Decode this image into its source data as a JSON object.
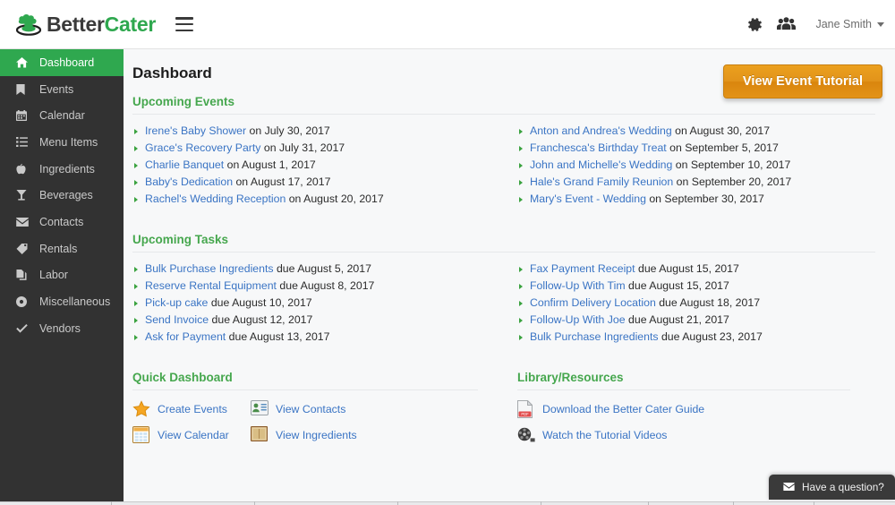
{
  "app": {
    "brand_primary": "Better",
    "brand_secondary": "Cater",
    "accent_green": "#2fa84f",
    "link_blue": "#3a74c4",
    "sidebar_bg": "#323232",
    "button_orange": "#e2931a"
  },
  "header": {
    "menu_icon": "hamburger-icon",
    "settings_icon": "gear-icon",
    "users_icon": "users-group-icon",
    "user_name": "Jane Smith",
    "user_caret": "chevron-down-icon"
  },
  "sidebar": {
    "items": [
      {
        "label": "Dashboard",
        "icon": "home-icon",
        "active": true
      },
      {
        "label": "Events",
        "icon": "bookmark-icon",
        "active": false
      },
      {
        "label": "Calendar",
        "icon": "calendar-icon",
        "active": false
      },
      {
        "label": "Menu Items",
        "icon": "list-icon",
        "active": false
      },
      {
        "label": "Ingredients",
        "icon": "apple-icon",
        "active": false
      },
      {
        "label": "Beverages",
        "icon": "cocktail-glass-icon",
        "active": false
      },
      {
        "label": "Contacts",
        "icon": "envelope-icon",
        "active": false
      },
      {
        "label": "Rentals",
        "icon": "tag-icon",
        "active": false
      },
      {
        "label": "Labor",
        "icon": "copy-icon",
        "active": false
      },
      {
        "label": "Miscellaneous",
        "icon": "circle-dot-icon",
        "active": false
      },
      {
        "label": "Vendors",
        "icon": "check-icon",
        "active": false
      }
    ]
  },
  "main": {
    "page_title": "Dashboard",
    "tutorial_button": "View Event Tutorial",
    "events": {
      "section_title": "Upcoming Events",
      "left": [
        {
          "name": "Irene's Baby Shower",
          "suffix": " on July 30, 2017"
        },
        {
          "name": "Grace's Recovery Party",
          "suffix": " on July 31, 2017"
        },
        {
          "name": "Charlie Banquet",
          "suffix": " on August 1, 2017"
        },
        {
          "name": "Baby's Dedication",
          "suffix": " on August 17, 2017"
        },
        {
          "name": "Rachel's Wedding Reception",
          "suffix": " on August 20, 2017"
        }
      ],
      "right": [
        {
          "name": "Anton and Andrea's Wedding",
          "suffix": " on August 30, 2017"
        },
        {
          "name": "Franchesca's Birthday Treat",
          "suffix": " on September 5, 2017"
        },
        {
          "name": "John and Michelle's Wedding",
          "suffix": " on September 10, 2017"
        },
        {
          "name": "Hale's Grand Family Reunion",
          "suffix": " on September 20, 2017"
        },
        {
          "name": "Mary's Event - Wedding",
          "suffix": " on September 30, 2017"
        }
      ]
    },
    "tasks": {
      "section_title": "Upcoming Tasks",
      "left": [
        {
          "name": "Bulk Purchase Ingredients",
          "suffix": " due August 5, 2017"
        },
        {
          "name": "Reserve Rental Equipment",
          "suffix": " due August 8, 2017"
        },
        {
          "name": "Pick-up cake",
          "suffix": " due August 10, 2017"
        },
        {
          "name": "Send Invoice",
          "suffix": " due August 12, 2017"
        },
        {
          "name": "Ask for Payment",
          "suffix": " due August 13, 2017"
        }
      ],
      "right": [
        {
          "name": "Fax Payment Receipt",
          "suffix": " due August 15, 2017"
        },
        {
          "name": "Follow-Up With Tim",
          "suffix": " due August 15, 2017"
        },
        {
          "name": "Confirm Delivery Location",
          "suffix": " due August 18, 2017"
        },
        {
          "name": "Follow-Up With Joe",
          "suffix": " due August 21, 2017"
        },
        {
          "name": "Bulk Purchase Ingredients",
          "suffix": " due August 23, 2017"
        }
      ]
    },
    "quick_dashboard": {
      "section_title": "Quick Dashboard",
      "items": [
        {
          "label": "Create Events",
          "icon": "star-icon"
        },
        {
          "label": "View Contacts",
          "icon": "contact-card-icon"
        },
        {
          "label": "View Calendar",
          "icon": "calendar-page-icon"
        },
        {
          "label": "View Ingredients",
          "icon": "box-icon"
        }
      ]
    },
    "library": {
      "section_title": "Library/Resources",
      "items": [
        {
          "label": "Download the Better Cater Guide",
          "icon": "pdf-file-icon"
        },
        {
          "label": "Watch the Tutorial Videos",
          "icon": "film-reel-icon"
        }
      ]
    }
  },
  "chat": {
    "label": "Have a question?",
    "icon": "envelope-icon"
  }
}
